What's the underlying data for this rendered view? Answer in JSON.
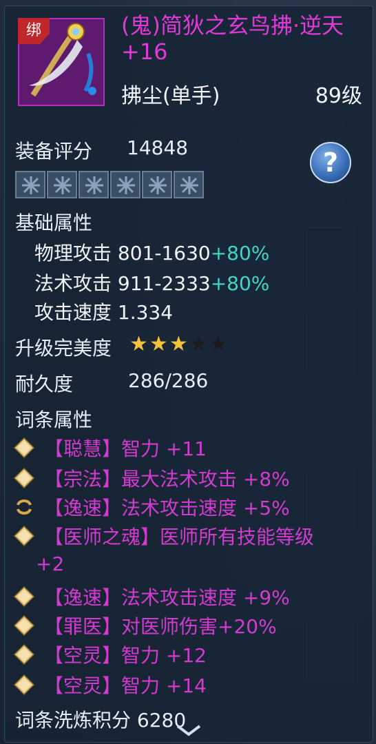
{
  "item": {
    "bind_label": "绑",
    "name": "(鬼)简狄之玄鸟拂·逆天 +16",
    "subtype": "拂尘(单手)",
    "level": "89级"
  },
  "score": {
    "label": "装备评分",
    "value": "14848"
  },
  "gem_slots": 6,
  "base": {
    "header": "基础属性",
    "attrs": [
      {
        "label": "物理攻击 801-1630",
        "bonus": "+80%"
      },
      {
        "label": "法术攻击 911-2333",
        "bonus": "+80%"
      },
      {
        "label": "攻击速度 1.334",
        "bonus": ""
      }
    ]
  },
  "perfection": {
    "label": "升级完美度",
    "stars_filled": 3,
    "stars_total": 5
  },
  "durability": {
    "label": "耐久度",
    "value": "286/286"
  },
  "affixes": {
    "header": "词条属性",
    "items": [
      {
        "icon": "diamond-icon",
        "text": "【聪慧】智力 +11"
      },
      {
        "icon": "diamond-icon",
        "text": "【宗法】最大法术攻击 +8%"
      },
      {
        "icon": "swirl-icon",
        "text": "【逸速】法术攻击速度 +5%"
      },
      {
        "icon": "diamond-icon",
        "text": "【医师之魂】医师所有技能等级"
      },
      {
        "icon": "diamond-icon",
        "text": "【逸速】法术攻击速度 +9%"
      },
      {
        "icon": "diamond-icon",
        "text": "【罪医】对医师伤害+20%"
      },
      {
        "icon": "diamond-icon",
        "text": "【空灵】智力 +12"
      },
      {
        "icon": "diamond-icon",
        "text": "【空灵】智力 +14"
      }
    ],
    "continuation": "+2"
  },
  "footer": {
    "text": "词条洗炼积分 6280"
  },
  "colors": {
    "name": "#e03ad8",
    "affix": "#d33ad0",
    "bonus": "#3fd6c8",
    "star": "#f4c23a"
  }
}
